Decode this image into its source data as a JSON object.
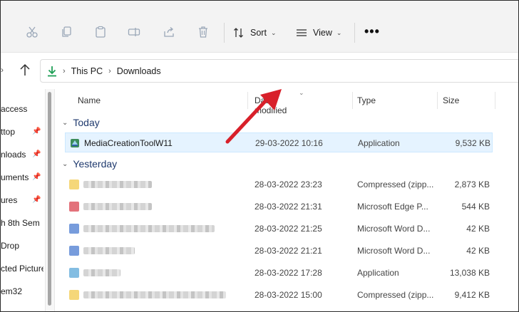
{
  "toolbar": {
    "icons": [
      "cut-icon",
      "copy-icon",
      "paste-icon",
      "rename-icon",
      "share-icon",
      "delete-icon"
    ],
    "sort_label": "Sort",
    "view_label": "View",
    "more_label": "•••"
  },
  "address": {
    "crumbs": [
      "This PC",
      "Downloads"
    ]
  },
  "sidebar": {
    "items": [
      {
        "label": "access",
        "pinned": false
      },
      {
        "label": "ttop",
        "pinned": true
      },
      {
        "label": "nloads",
        "pinned": true
      },
      {
        "label": "uments",
        "pinned": true
      },
      {
        "label": "ures",
        "pinned": true
      },
      {
        "label": "h 8th Sem",
        "pinned": false
      },
      {
        "label": "Drop",
        "pinned": false
      },
      {
        "label": "cted Picture",
        "pinned": false
      },
      {
        "label": "em32",
        "pinned": false
      }
    ]
  },
  "columns": {
    "name": "Name",
    "date": "Date modified",
    "type": "Type",
    "size": "Size"
  },
  "groups": {
    "today": "Today",
    "yesterday": "Yesterday"
  },
  "today_rows": [
    {
      "name": "MediaCreationToolW11",
      "date": "29-03-2022 10:16",
      "type": "Application",
      "size": "9,532 KB"
    }
  ],
  "yesterday_rows": [
    {
      "date": "28-03-2022 23:23",
      "type": "Compressed (zipp...",
      "size": "2,873 KB",
      "icon_color": "#f2c94c"
    },
    {
      "date": "28-03-2022 21:31",
      "type": "Microsoft Edge P...",
      "size": "544 KB",
      "icon_color": "#d9434f"
    },
    {
      "date": "28-03-2022 21:25",
      "type": "Microsoft Word D...",
      "size": "42 KB",
      "icon_color": "#4a7bd0"
    },
    {
      "date": "28-03-2022 21:21",
      "type": "Microsoft Word D...",
      "size": "42 KB",
      "icon_color": "#4a7bd0"
    },
    {
      "date": "28-03-2022 17:28",
      "type": "Application",
      "size": "13,038 KB",
      "icon_color": "#5aa7d8"
    },
    {
      "date": "28-03-2022 15:00",
      "type": "Compressed (zipp...",
      "size": "9,412 KB",
      "icon_color": "#f2c94c"
    }
  ],
  "colors": {
    "accent": "#d8202a",
    "selection": "#e5f3ff",
    "group_heading": "#1f3a6e",
    "downloads_icon": "#1d9e55"
  }
}
